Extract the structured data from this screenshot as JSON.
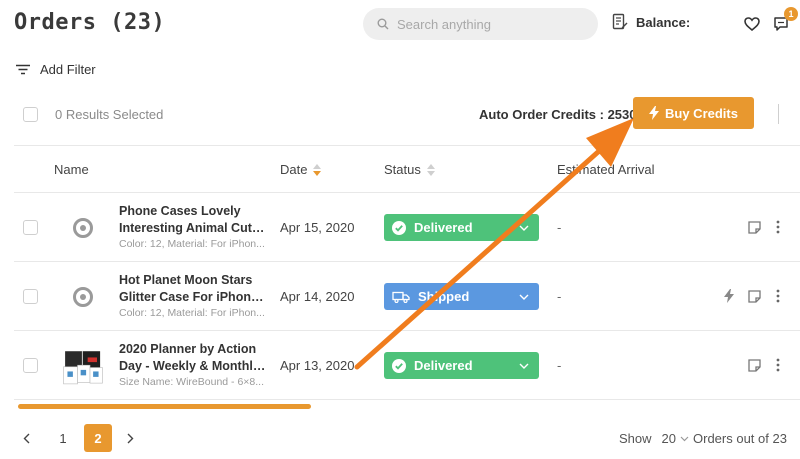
{
  "header": {
    "title": "Orders (23)",
    "search_placeholder": "Search anything",
    "balance_label": "Balance:",
    "notification_count": "1"
  },
  "toolbar": {
    "filter_label": "Add Filter",
    "selected_label": "0 Results Selected",
    "credits_label": "Auto Order Credits : 2530",
    "buy_label": "Buy Credits"
  },
  "table": {
    "columns": [
      "Name",
      "Date",
      "Status",
      "Estimated Arrival"
    ],
    "rows": [
      {
        "name_line1": "Phone Cases Lovely",
        "name_line2": "Interesting Animal Cute...",
        "sub": "Color: 12, Material: For iPhon...",
        "date": "Apr 15, 2020",
        "status": "Delivered",
        "arrival": "-"
      },
      {
        "name_line1": "Hot Planet Moon Stars",
        "name_line2": "Glitter Case For iPhone ...",
        "sub": "Color: 12, Material: For iPhon...",
        "date": "Apr 14, 2020",
        "status": "Shipped",
        "arrival": "-"
      },
      {
        "name_line1": "2020 Planner by Action",
        "name_line2": "Day - Weekly & Monthly...",
        "sub": "Size Name: WireBound - 6×8...",
        "date": "Apr 13, 2020",
        "status": "Delivered",
        "arrival": "-"
      }
    ]
  },
  "pagination": {
    "pages": [
      "1",
      "2"
    ],
    "current": "2",
    "show_label": "Show",
    "per_page": "20",
    "suffix": "Orders out of 23"
  },
  "colors": {
    "accent": "#e8982f",
    "delivered": "#4ec27a",
    "shipped": "#5b98e0"
  }
}
